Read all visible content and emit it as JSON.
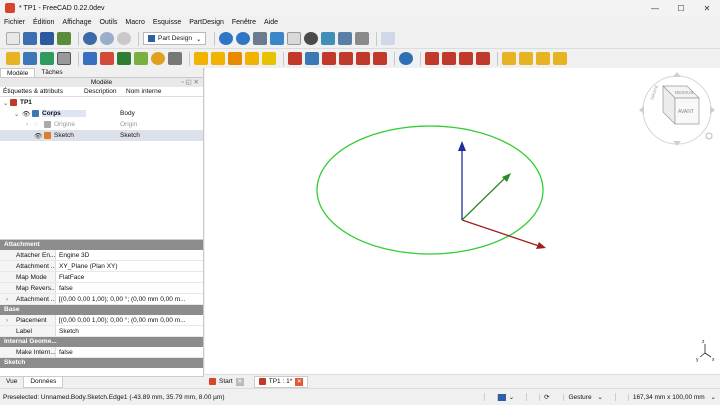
{
  "window": {
    "title": "* TP1 - FreeCAD 0.22.0dev",
    "controls": [
      "—",
      "☐",
      "✕"
    ]
  },
  "menu": [
    "Fichier",
    "Édition",
    "Affichage",
    "Outils",
    "Macro",
    "Esquisse",
    "PartDesign",
    "Fenêtre",
    "Aide"
  ],
  "toolbar": {
    "workbench": "Part Design"
  },
  "left_panel": {
    "tabs": [
      "Modèle",
      "Tâches"
    ],
    "header": "Modèle",
    "columns": [
      "Étiquettes & attributs",
      "Description",
      "Nom interne"
    ],
    "tree": [
      {
        "label": "TP1",
        "internal": ""
      },
      {
        "label": "Corps",
        "internal": "Body"
      },
      {
        "label": "Origine",
        "internal": "Origin"
      },
      {
        "label": "Sketch",
        "internal": "Sketch"
      }
    ],
    "properties": [
      {
        "group": "Attachment",
        "rows": [
          {
            "key": "Attacher En...",
            "value": "Engine 3D"
          },
          {
            "key": "Attachment ...",
            "value": "XY_Plane (Plan XY)"
          },
          {
            "key": "Map Mode",
            "value": "FlatFace"
          },
          {
            "key": "Map Revers...",
            "value": "false"
          },
          {
            "key": "Attachment ...",
            "value": "[(0,00 0,00 1,00); 0,00 °; (0,00 mm  0,00 m..."
          }
        ]
      },
      {
        "group": "Base",
        "rows": [
          {
            "key": "Placement",
            "value": "[(0,00 0,00 1,00); 0,00 °; (0,00 mm  0,00 m..."
          },
          {
            "key": "Label",
            "value": "Sketch"
          }
        ]
      },
      {
        "group": "Internal Geome...",
        "rows": [
          {
            "key": "Make Intern...",
            "value": "false"
          }
        ]
      },
      {
        "group": "Sketch",
        "rows": []
      }
    ],
    "bottom_tabs": [
      "Vue",
      "Données"
    ]
  },
  "doc_tabs": [
    "Start",
    "TP1 : 1*"
  ],
  "navcube": {
    "top": "DESSUS",
    "front": "AVANT",
    "right": "DROITE"
  },
  "status": {
    "message": "Preselected: Unnamed.Body.Sketch.Edge1 (-43.89 mm, 35.79 mm, 8.00 µm)",
    "nav_style": "Gesture",
    "dimensions": "167,34 mm x 100,00 mm"
  },
  "colors": {
    "circle": "#33cc33",
    "axis_x": "#a01f1f",
    "axis_y": "#2c8a2c",
    "axis_z": "#1f2f9a"
  }
}
